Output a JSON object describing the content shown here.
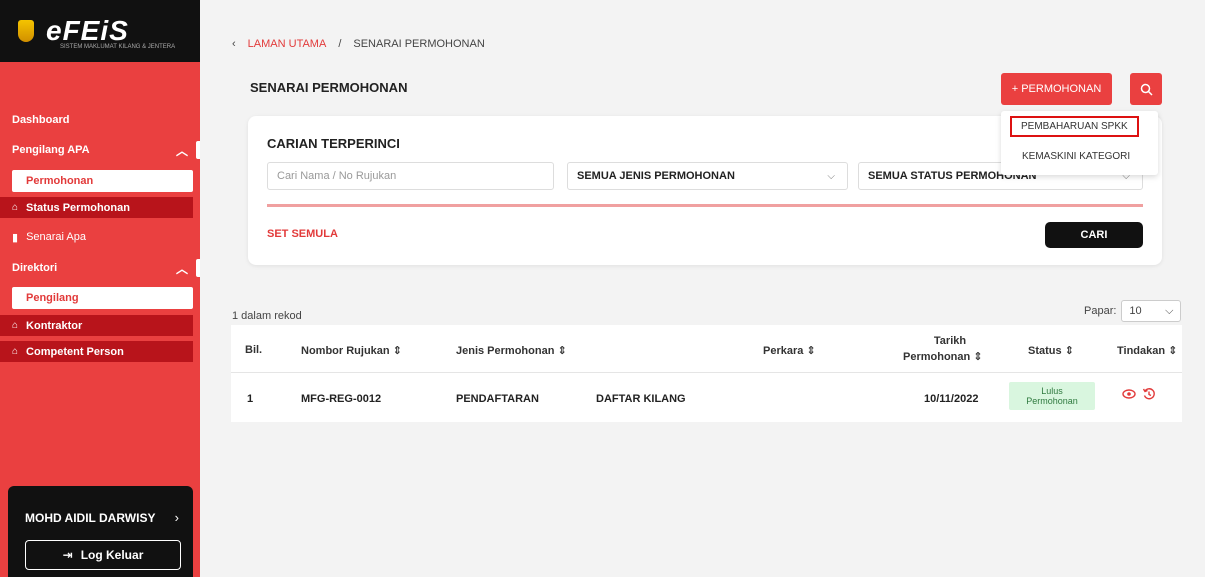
{
  "sidebar": {
    "brand": "eFEiS",
    "tagline": "SISTEM MAKLUMAT KILANG & JENTERA",
    "dashboard": "Dashboard",
    "group1": "Pengilang APA",
    "group1_sub": "Permohonan",
    "group1_item": "Status Permohonan",
    "plain_item": "Senarai Apa",
    "group2": "Direktori",
    "group2_sub": "Pengilang",
    "item_kontraktor": "Kontraktor",
    "item_competent": "Competent Person",
    "user_name": "MOHD AIDIL DARWISY",
    "logout": "Log Keluar"
  },
  "breadcrumb": {
    "home": "LAMAN UTAMA",
    "sep": "/",
    "current": "SENARAI PERMOHONAN"
  },
  "page_title": "SENARAI PERMOHONAN",
  "toolbar": {
    "new_label": "+ PERMOHONAN"
  },
  "dropdown": {
    "item1": "PEMBAHARUAN SPKK",
    "item2": "KEMASKINI KATEGORI"
  },
  "search": {
    "title": "CARIAN TERPERINCI",
    "placeholder": "Cari Nama / No Rujukan",
    "type_select": "SEMUA JENIS PERMOHONAN",
    "status_select": "SEMUA STATUS PERMOHONAN",
    "reset": "SET SEMULA",
    "find": "CARI"
  },
  "records": {
    "count_text": "1 dalam rekod",
    "show_label": "Papar:",
    "show_value": "10"
  },
  "table": {
    "headers": {
      "bil": "Bil.",
      "rujukan": "Nombor Rujukan ⇕",
      "jenis": "Jenis Permohonan ⇕",
      "perkara": "Perkara ⇕",
      "tarikh1": "Tarikh",
      "tarikh2": "Permohonan ⇕",
      "status": "Status ⇕",
      "tindakan": "Tindakan ⇕"
    },
    "rows": [
      {
        "bil": "1",
        "rujukan": "MFG-REG-0012",
        "jenis": "PENDAFTARAN",
        "perkara": "DAFTAR KILANG",
        "tarikh": "10/11/2022",
        "status1": "Lulus",
        "status2": "Permohonan"
      }
    ]
  },
  "colors": {
    "primary": "#ea4040",
    "dark": "#111111",
    "active": "#b8141b",
    "success_bg": "#d9f6df"
  }
}
